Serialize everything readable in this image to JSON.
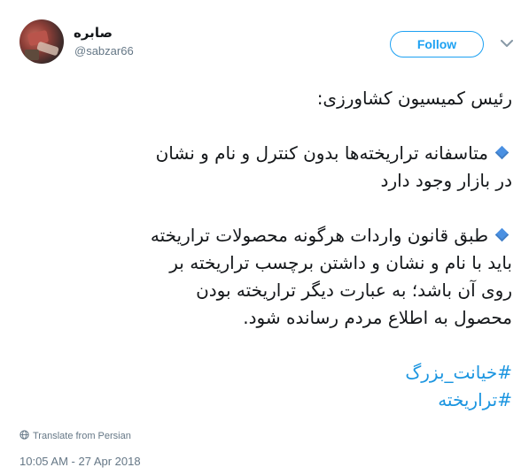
{
  "user": {
    "display_name": "صابره",
    "handle": "@sabzar66"
  },
  "actions": {
    "follow_label": "Follow",
    "menu_icon": "chevron-down-icon"
  },
  "tweet": {
    "title_line": "رئیس کمیسیون کشاورزی:",
    "para1_line1": "متاسفانه تراریخته‌ها بدون کنترل و نام و نشان",
    "para1_line2": "در بازار وجود دارد",
    "para2_line1": "طبق قانون واردات هرگونه محصولات تراریخته",
    "para2_line2": "باید با نام و نشان و داشتن برچسب تراریخته بر",
    "para2_line3": "روی آن باشد؛ به عبارت دیگر تراریخته بودن",
    "para2_line4": "محصول به اطلاع مردم رسانده شود.",
    "hashtag1": "#خیانت_بزرگ",
    "hashtag2": "#تراریخته",
    "bullet_icon": "small-blue-diamond-icon",
    "bullet_color": "#4a90e2"
  },
  "footer": {
    "translate_label": "Translate from Persian",
    "translate_icon": "globe-icon",
    "timestamp": "10:05 AM - 27 Apr 2018"
  },
  "colors": {
    "accent": "#1da1f2",
    "hashtag": "#1b95e0",
    "muted": "#657786",
    "text": "#14171a"
  }
}
